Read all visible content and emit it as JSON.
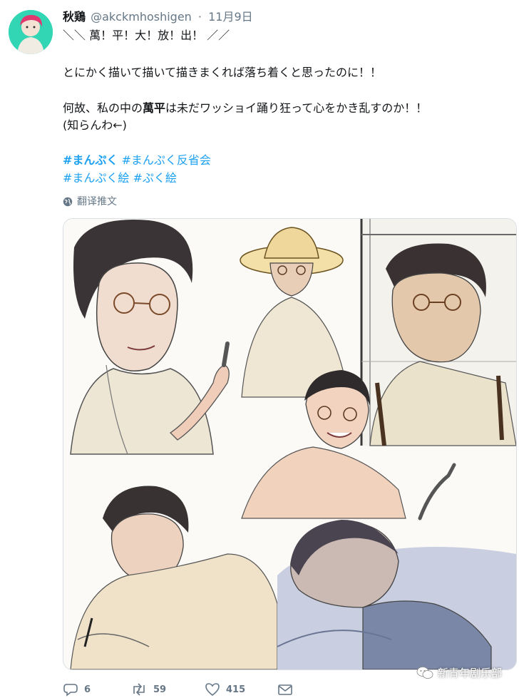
{
  "tweet": {
    "author_name": "秋鶏",
    "handle": "@akckmhoshigen",
    "dot": "·",
    "date": "11月9日",
    "lines": [
      "＼＼ 萬！平！大！放！出！ ／／",
      "とにかく描いて描いて描きまくれば落ち着くと思ったのに！！"
    ],
    "line3_before": "何故、私の中の",
    "line3_bold": "萬平",
    "line3_after": "は未だワッショイ踊り狂って心をかき乱すのか！！",
    "line4": "(知らんわ←)",
    "hashtags_row1": [
      "#まんぷく",
      "#まんぷく反省会"
    ],
    "hashtags_row2": [
      "#まんぷく絵",
      "#ぷく絵"
    ],
    "translate_label": "翻译推文"
  },
  "actions": {
    "reply_count": "6",
    "retweet_count": "59",
    "like_count": "415"
  },
  "watermark": {
    "text": "新青年剧乐部"
  },
  "colors": {
    "link": "#1da1f2",
    "secondary": "#657786",
    "text": "#14171a"
  }
}
